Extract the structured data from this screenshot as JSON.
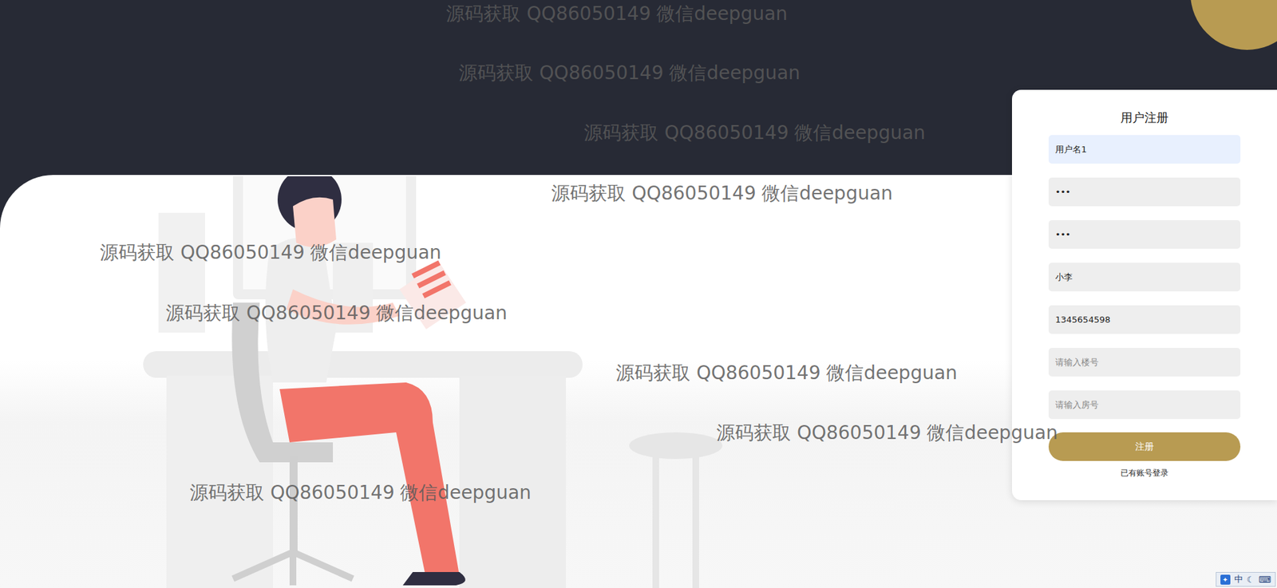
{
  "form": {
    "title": "用户注册",
    "fields": [
      {
        "kind": "value",
        "value": "用户名1",
        "autofilled": true
      },
      {
        "kind": "value",
        "value": "•••",
        "autofilled": false
      },
      {
        "kind": "value",
        "value": "•••",
        "autofilled": false
      },
      {
        "kind": "value",
        "value": "小李",
        "autofilled": false
      },
      {
        "kind": "value",
        "value": "1345654598",
        "autofilled": false
      },
      {
        "kind": "placeholder",
        "placeholder": "请输入楼号",
        "autofilled": false
      },
      {
        "kind": "placeholder",
        "placeholder": "请输入房号",
        "autofilled": false
      }
    ],
    "submit": "注册",
    "login_link": "已有账号登录"
  },
  "watermarks": [
    "源码获取 QQ86050149 微信deepguan",
    "源码获取 QQ86050149 微信deepguan",
    "源码获取 QQ86050149 微信deepguan",
    "源码获取 QQ86050149 微信deepguan",
    "源码获取 QQ86050149 微信deepguan",
    "源码获取 QQ86050149 微信deepguan",
    "源码获取 QQ86050149 微信deepguan",
    "源码获取 QQ86050149 微信deepguan",
    "源码获取 QQ86050149 微信deepguan"
  ],
  "ime_bar": {
    "mode": "中"
  }
}
